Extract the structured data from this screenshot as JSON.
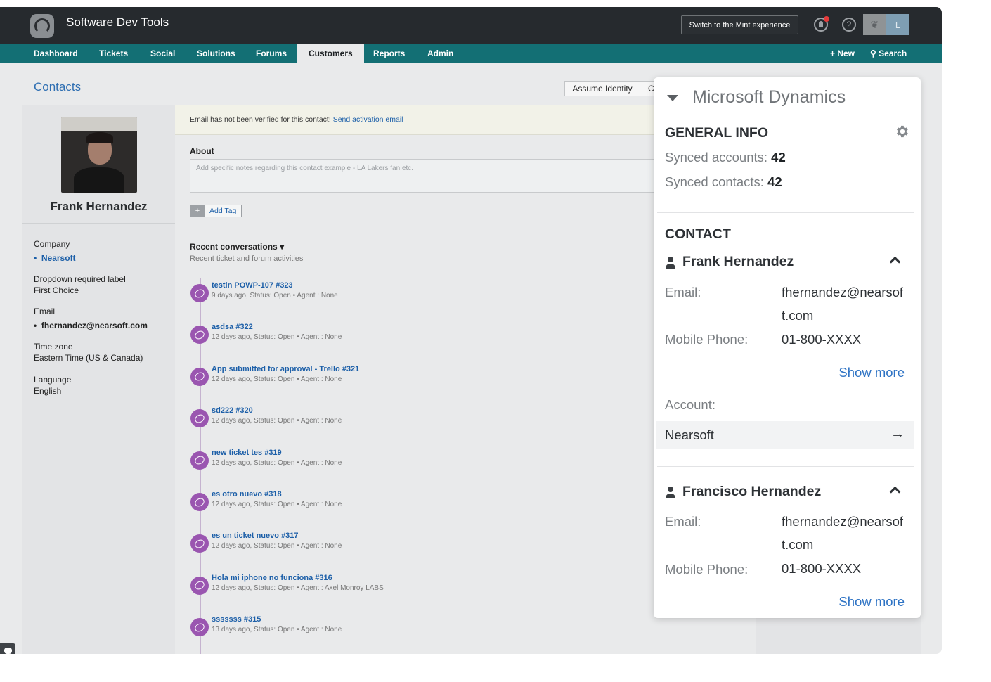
{
  "header": {
    "app_title": "Software Dev Tools",
    "mint_button": "Switch to the Mint experience",
    "help_glyph": "?",
    "profile_initial": "L"
  },
  "nav": {
    "items": [
      "Dashboard",
      "Tickets",
      "Social",
      "Solutions",
      "Forums",
      "Customers",
      "Reports",
      "Admin"
    ],
    "active": "Customers",
    "new_label": "+ New",
    "search_label": "Search"
  },
  "page": {
    "title": "Contacts",
    "assume_identity": "Assume Identity",
    "second_button_partial": "C"
  },
  "contact": {
    "name": "Frank Hernandez",
    "fields": [
      {
        "label": "Company",
        "value": "Nearsoft"
      },
      {
        "label": "Dropdown required label",
        "value": "First Choice"
      },
      {
        "label": "Email",
        "value": "fhernandez@nearsoft.com"
      },
      {
        "label": "Time zone",
        "value": "Eastern Time (US & Canada)"
      },
      {
        "label": "Language",
        "value": "English"
      }
    ]
  },
  "main": {
    "warning": "Email has not been verified for this contact!",
    "warning_link": "Send activation email",
    "about_label": "About",
    "about_placeholder": "Add specific notes regarding this contact example - LA Lakers fan etc.",
    "add_tag": "Add Tag",
    "add_tag_plus": "+",
    "recent_title": "Recent conversations",
    "recent_sub": "Recent ticket and forum activities",
    "conversations": [
      {
        "title": "testin POWP-107 #323",
        "meta": "9 days ago, Status: Open  •  Agent : None"
      },
      {
        "title": "asdsa #322",
        "meta": "12 days ago, Status: Open  •  Agent : None"
      },
      {
        "title": "App submitted for approval - Trello #321",
        "meta": "12 days ago, Status: Open  •  Agent : None"
      },
      {
        "title": "sd222 #320",
        "meta": "12 days ago, Status: Open  •  Agent : None"
      },
      {
        "title": "new ticket tes #319",
        "meta": "12 days ago, Status: Open  •  Agent : None"
      },
      {
        "title": "es otro nuevo #318",
        "meta": "12 days ago, Status: Open  •  Agent : None"
      },
      {
        "title": "es un ticket nuevo #317",
        "meta": "12 days ago, Status: Open  •  Agent : None"
      },
      {
        "title": "Hola mi iphone no funciona #316",
        "meta": "12 days ago, Status: Open  •  Agent : Axel Monroy LABS"
      },
      {
        "title": "sssssss #315",
        "meta": "13 days ago, Status: Open  •  Agent : None"
      }
    ]
  },
  "dynamics": {
    "title": "Microsoft Dynamics",
    "general_info": "GENERAL INFO",
    "synced_accounts_label": "Synced accounts:",
    "synced_accounts": "42",
    "synced_contacts_label": "Synced contacts:",
    "synced_contacts": "42",
    "contact_head": "CONTACT",
    "people": [
      {
        "name": "Frank Hernandez",
        "email_label": "Email:",
        "email": "fhernandez@nearsoft.com",
        "phone_label": "Mobile Phone:",
        "phone": "01-800-XXXX",
        "show_more": "Show more"
      },
      {
        "name": "Francisco Hernandez",
        "email_label": "Email:",
        "email": "fhernandez@nearsoft.com",
        "phone_label": "Mobile Phone:",
        "phone": "01-800-XXXX",
        "show_more": "Show more"
      }
    ],
    "account_label": "Account:",
    "account_name": "Nearsoft",
    "account_arrow": "→"
  },
  "colors": {
    "topbar": "#262a2e",
    "navbar": "#136f74",
    "link": "#1c5fa8",
    "conversation_icon": "#9a56b0",
    "panel_link": "#2e73c4"
  }
}
